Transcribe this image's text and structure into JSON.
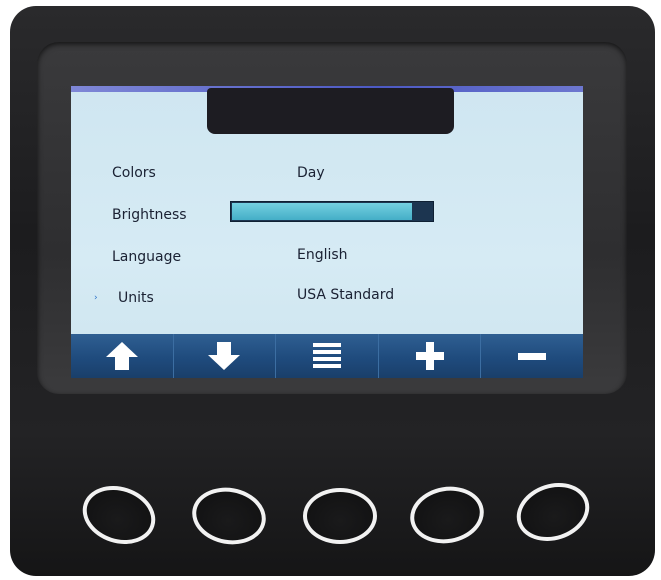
{
  "settings": {
    "rows": [
      {
        "label": "Colors",
        "value": "Day"
      },
      {
        "label": "Brightness",
        "value": null
      },
      {
        "label": "Language",
        "value": "English"
      },
      {
        "label": "Units",
        "value": "USA Standard"
      }
    ],
    "brightness_level": 0.9,
    "selected_row": "Units",
    "selected_marker": "›"
  },
  "softkeys": [
    {
      "name": "arrow-up-icon"
    },
    {
      "name": "arrow-down-icon"
    },
    {
      "name": "menu-icon"
    },
    {
      "name": "plus-icon"
    },
    {
      "name": "minus-icon"
    }
  ],
  "colors": {
    "screen_bg": "#d6ebf4",
    "softkey_bar": "#1f4b7d",
    "brightness_fill": "#44aec7",
    "bezel": "#1c1c1e"
  }
}
